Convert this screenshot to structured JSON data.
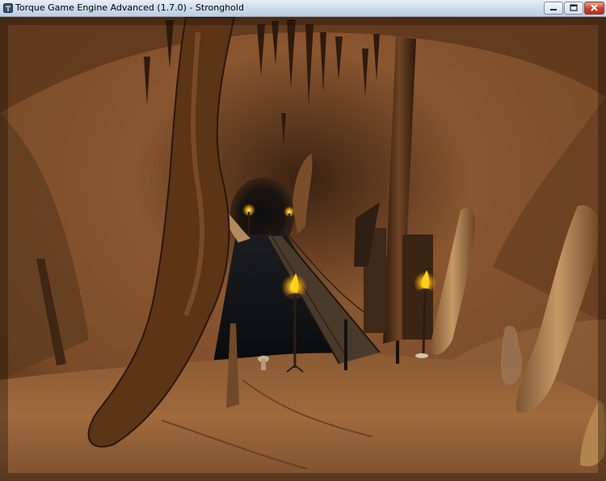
{
  "window": {
    "title": "Torque Game Engine Advanced (1.7.0) - Stronghold",
    "icon": "torque-app-icon",
    "controls": [
      "minimize-icon",
      "maximize-icon",
      "close-icon"
    ]
  },
  "scene": {
    "description_icons": [
      "torch-icon",
      "bridge-icon",
      "stalactite-icon",
      "stalagmite-icon",
      "column-icon"
    ],
    "colors": {
      "rock_dark": "#2a180c",
      "rock_mid": "#6b3f20",
      "rock_light": "#a4703f",
      "torch_flame": "#ffd21a",
      "void": "#0c0d10"
    }
  }
}
